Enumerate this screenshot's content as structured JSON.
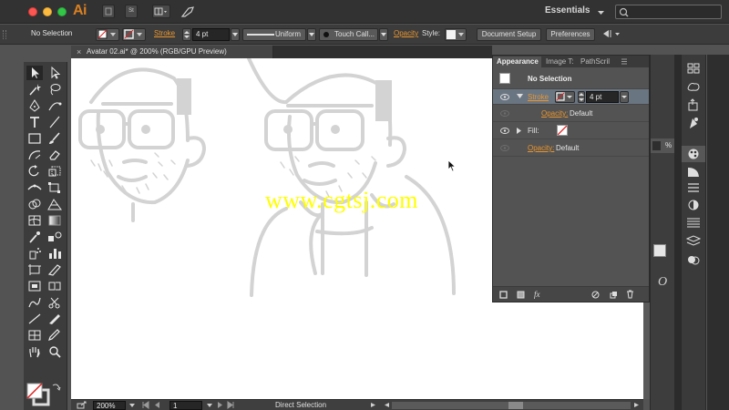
{
  "app": {
    "logo": "Ai",
    "workspace": "Essentials"
  },
  "control_bar": {
    "selection": "No Selection",
    "stroke_label": "Stroke",
    "stroke_weight": "4 pt",
    "profile": "Uniform",
    "brush": "Touch Call...",
    "opacity_label": "Opacity",
    "style_label": "Style:",
    "document_setup": "Document Setup",
    "preferences": "Preferences"
  },
  "document": {
    "tab_title": "Avatar 02.ai* @ 200% (RGB/GPU Preview)",
    "close_glyph": "×",
    "watermark": "www.cgtsj.com"
  },
  "status_bar": {
    "zoom": "200%",
    "artboard": "1",
    "tool": "Direct Selection"
  },
  "appearance_panel": {
    "tabs": [
      "Appearance",
      "Image T:",
      "PathScril"
    ],
    "header": "No Selection",
    "stroke_label": "Stroke",
    "stroke_weight": "4 pt",
    "stroke_opacity": "Opacity:",
    "stroke_opacity_value": "Default",
    "fill_label": "Fill:",
    "fill_opacity": "Opacity:",
    "fill_opacity_value": "Default",
    "footer_fx": "fx"
  },
  "right_dock": {
    "percent_sign": "%",
    "opacity_glyph": "O"
  },
  "colors": {
    "accent_orange": "#e8952e",
    "ai_logo": "#d98021",
    "watermark": "#ffff00",
    "drawing_line": "#d3d3d3"
  }
}
